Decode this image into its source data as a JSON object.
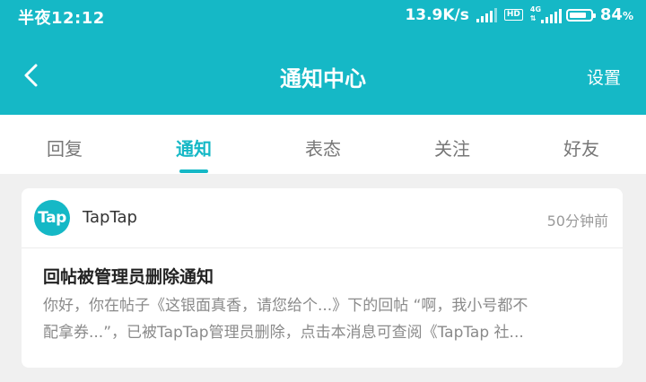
{
  "status_bar": {
    "time": "半夜12:12",
    "net_speed": "13.9K/s",
    "hd": "HD",
    "network": "4G",
    "battery_level": 0.84,
    "battery_pct": "84",
    "battery_unit": "%"
  },
  "nav": {
    "back_icon": "chevron-left-icon",
    "title": "通知中心",
    "settings_label": "设置"
  },
  "tabs": [
    {
      "label": "回复",
      "active": false
    },
    {
      "label": "通知",
      "active": true
    },
    {
      "label": "表态",
      "active": false
    },
    {
      "label": "关注",
      "active": false
    },
    {
      "label": "好友",
      "active": false
    }
  ],
  "notification": {
    "avatar_text": "Tap",
    "sender": "TapTap",
    "time": "50分钟前",
    "title": "回帖被管理员删除通知",
    "body_line1": "你好，你在帖子《这银面真香，请您给个...》下的回帖 “啊，我小号都不",
    "body_line2": "配拿券...”，已被TapTap管理员删除，点击本消息可查阅《TapTap 社..."
  },
  "colors": {
    "accent": "#15b8c6",
    "background": "#f0f0f0"
  }
}
